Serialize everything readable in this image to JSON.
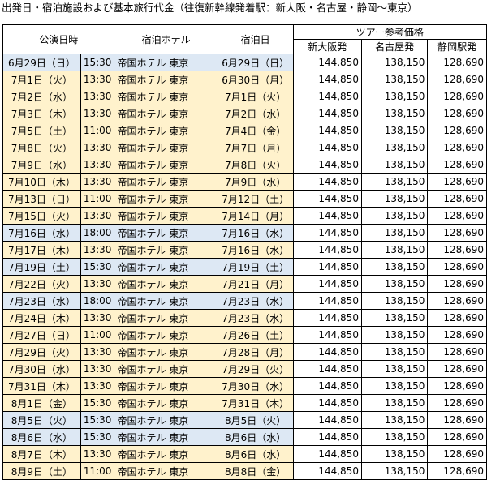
{
  "title": "出発日・宿泊施設および基本旅行代金（往復新幹線発着駅：新大阪・名古屋・静岡〜東京）",
  "headers": {
    "performance": "公演日時",
    "hotel": "宿泊ホテル",
    "stay_date": "宿泊日",
    "tour_price": "ツアー参考価格",
    "shin_osaka": "新大阪発",
    "nagoya": "名古屋発",
    "shizuoka": "静岡駅発"
  },
  "colors": {
    "blue_row": "#dde8f4",
    "yellow_row": "#fff2cc"
  },
  "rows": [
    {
      "date": "6月29日（日）",
      "time": "15:30",
      "hotel": "帝国ホテル 東京",
      "stay": "6月29日（日）",
      "osaka": "144,850",
      "nagoya": "138,150",
      "shizuoka": "128,690",
      "color": "blue"
    },
    {
      "date": "7月1日（火）",
      "time": "13:30",
      "hotel": "帝国ホテル 東京",
      "stay": "6月30日（月）",
      "osaka": "144,850",
      "nagoya": "138,150",
      "shizuoka": "128,690",
      "color": "yellow"
    },
    {
      "date": "7月2日（水）",
      "time": "13:30",
      "hotel": "帝国ホテル 東京",
      "stay": "7月1日（火）",
      "osaka": "144,850",
      "nagoya": "138,150",
      "shizuoka": "128,690",
      "color": "yellow"
    },
    {
      "date": "7月3日（木）",
      "time": "13:30",
      "hotel": "帝国ホテル 東京",
      "stay": "7月2日（水）",
      "osaka": "144,850",
      "nagoya": "138,150",
      "shizuoka": "128,690",
      "color": "yellow"
    },
    {
      "date": "7月5日（土）",
      "time": "11:00",
      "hotel": "帝国ホテル 東京",
      "stay": "7月4日（金）",
      "osaka": "144,850",
      "nagoya": "138,150",
      "shizuoka": "128,690",
      "color": "yellow"
    },
    {
      "date": "7月8日（火）",
      "time": "13:30",
      "hotel": "帝国ホテル 東京",
      "stay": "7月7日（月）",
      "osaka": "144,850",
      "nagoya": "138,150",
      "shizuoka": "128,690",
      "color": "yellow"
    },
    {
      "date": "7月9日（水）",
      "time": "13:30",
      "hotel": "帝国ホテル 東京",
      "stay": "7月8日（火）",
      "osaka": "144,850",
      "nagoya": "138,150",
      "shizuoka": "128,690",
      "color": "yellow"
    },
    {
      "date": "7月10日（木）",
      "time": "13:30",
      "hotel": "帝国ホテル 東京",
      "stay": "7月9日（水）",
      "osaka": "144,850",
      "nagoya": "138,150",
      "shizuoka": "128,690",
      "color": "yellow"
    },
    {
      "date": "7月13日（日）",
      "time": "11:00",
      "hotel": "帝国ホテル 東京",
      "stay": "7月12日（土）",
      "osaka": "144,850",
      "nagoya": "138,150",
      "shizuoka": "128,690",
      "color": "yellow"
    },
    {
      "date": "7月15日（火）",
      "time": "13:30",
      "hotel": "帝国ホテル 東京",
      "stay": "7月14日（月）",
      "osaka": "144,850",
      "nagoya": "138,150",
      "shizuoka": "128,690",
      "color": "yellow"
    },
    {
      "date": "7月16日（水）",
      "time": "18:00",
      "hotel": "帝国ホテル 東京",
      "stay": "7月16日（水）",
      "osaka": "144,850",
      "nagoya": "138,150",
      "shizuoka": "128,690",
      "color": "blue"
    },
    {
      "date": "7月17日（木）",
      "time": "13:30",
      "hotel": "帝国ホテル 東京",
      "stay": "7月16日（水）",
      "osaka": "144,850",
      "nagoya": "138,150",
      "shizuoka": "128,690",
      "color": "yellow"
    },
    {
      "date": "7月19日（土）",
      "time": "15:30",
      "hotel": "帝国ホテル 東京",
      "stay": "7月19日（土）",
      "osaka": "144,850",
      "nagoya": "138,150",
      "shizuoka": "128,690",
      "color": "blue"
    },
    {
      "date": "7月22日（火）",
      "time": "13:30",
      "hotel": "帝国ホテル 東京",
      "stay": "7月21日（月）",
      "osaka": "144,850",
      "nagoya": "138,150",
      "shizuoka": "128,690",
      "color": "yellow"
    },
    {
      "date": "7月23日（水）",
      "time": "18:00",
      "hotel": "帝国ホテル 東京",
      "stay": "7月23日（水）",
      "osaka": "144,850",
      "nagoya": "138,150",
      "shizuoka": "128,690",
      "color": "blue"
    },
    {
      "date": "7月24日（木）",
      "time": "13:30",
      "hotel": "帝国ホテル 東京",
      "stay": "7月23日（水）",
      "osaka": "144,850",
      "nagoya": "138,150",
      "shizuoka": "128,690",
      "color": "yellow"
    },
    {
      "date": "7月27日（日）",
      "time": "11:00",
      "hotel": "帝国ホテル 東京",
      "stay": "7月26日（土）",
      "osaka": "144,850",
      "nagoya": "138,150",
      "shizuoka": "128,690",
      "color": "yellow"
    },
    {
      "date": "7月29日（火）",
      "time": "13:30",
      "hotel": "帝国ホテル 東京",
      "stay": "7月28日（月）",
      "osaka": "144,850",
      "nagoya": "138,150",
      "shizuoka": "128,690",
      "color": "yellow"
    },
    {
      "date": "7月30日（水）",
      "time": "13:30",
      "hotel": "帝国ホテル 東京",
      "stay": "7月29日（火）",
      "osaka": "144,850",
      "nagoya": "138,150",
      "shizuoka": "128,690",
      "color": "yellow"
    },
    {
      "date": "7月31日（木）",
      "time": "13:30",
      "hotel": "帝国ホテル 東京",
      "stay": "7月30日（水）",
      "osaka": "144,850",
      "nagoya": "138,150",
      "shizuoka": "128,690",
      "color": "yellow"
    },
    {
      "date": "8月1日（金）",
      "time": "15:30",
      "hotel": "帝国ホテル 東京",
      "stay": "7月31日（木）",
      "osaka": "144,850",
      "nagoya": "138,150",
      "shizuoka": "128,690",
      "color": "yellow"
    },
    {
      "date": "8月5日（火）",
      "time": "15:30",
      "hotel": "帝国ホテル 東京",
      "stay": "8月5日（火）",
      "osaka": "144,850",
      "nagoya": "138,150",
      "shizuoka": "128,690",
      "color": "blue"
    },
    {
      "date": "8月6日（水）",
      "time": "15:30",
      "hotel": "帝国ホテル 東京",
      "stay": "8月6日（水）",
      "osaka": "144,850",
      "nagoya": "138,150",
      "shizuoka": "128,690",
      "color": "blue"
    },
    {
      "date": "8月7日（木）",
      "time": "13:30",
      "hotel": "帝国ホテル 東京",
      "stay": "8月6日（水）",
      "osaka": "144,850",
      "nagoya": "138,150",
      "shizuoka": "128,690",
      "color": "yellow"
    },
    {
      "date": "8月9日（土）",
      "time": "11:00",
      "hotel": "帝国ホテル 東京",
      "stay": "8月8日（金）",
      "osaka": "144,850",
      "nagoya": "138,150",
      "shizuoka": "128,690",
      "color": "yellow"
    }
  ]
}
